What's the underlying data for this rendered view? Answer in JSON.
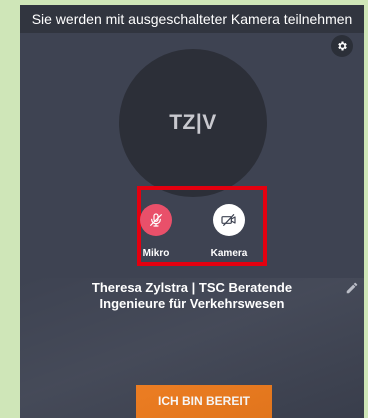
{
  "notice": {
    "text": "Sie werden mit ausgeschalteter Kamera teilnehmen"
  },
  "settings": {
    "icon": "gear-icon"
  },
  "avatar": {
    "initials": "TZ|V"
  },
  "controls": {
    "mic": {
      "label": "Mikro",
      "state": "muted",
      "icon": "microphone-off-icon",
      "color": "#e9506a"
    },
    "camera": {
      "label": "Kamera",
      "state": "off",
      "icon": "camera-off-icon",
      "color": "#ffffff"
    },
    "highlight_color": "#e3000f"
  },
  "participant": {
    "name_line1": "Theresa Zylstra | TSC Beratende",
    "name_line2": "Ingenieure für Verkehrswesen",
    "edit_icon": "pencil-icon"
  },
  "ready_button": {
    "label": "ICH BIN BEREIT",
    "color": "#ef7b1c"
  }
}
